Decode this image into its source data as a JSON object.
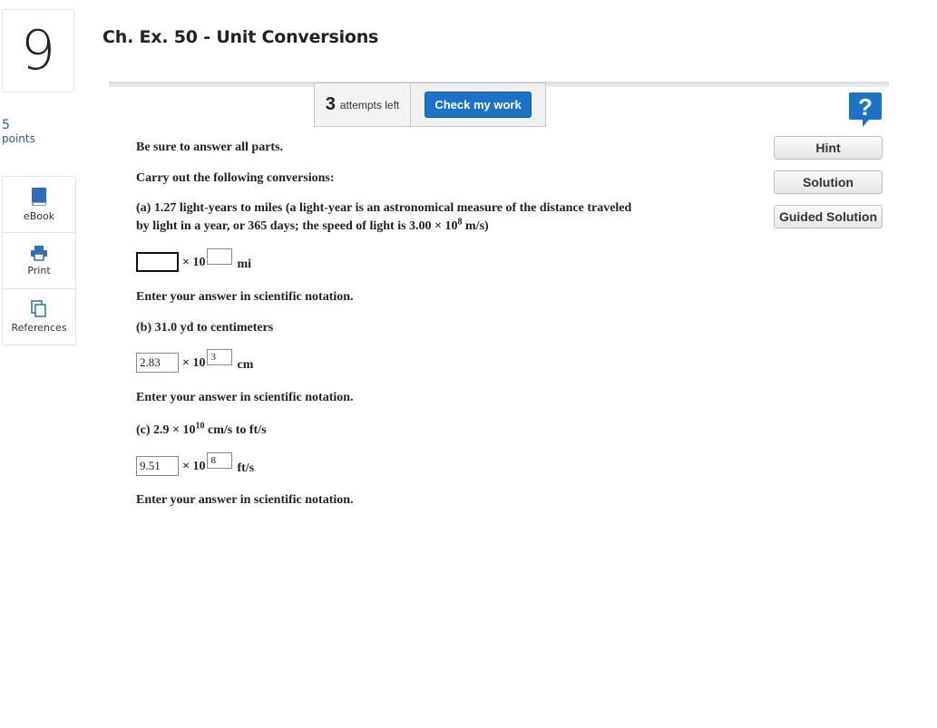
{
  "question": {
    "number": "9",
    "points_value": "5",
    "points_label": "points",
    "title": "Ch. Ex. 50 - Unit Conversions"
  },
  "tools": [
    {
      "label": "eBook",
      "icon": "book-icon"
    },
    {
      "label": "Print",
      "icon": "printer-icon"
    },
    {
      "label": "References",
      "icon": "copy-icon"
    }
  ],
  "attempts": {
    "count": "3",
    "label": "attempts left",
    "check_button": "Check my work"
  },
  "side_buttons": {
    "hint": "Hint",
    "solution": "Solution",
    "guided": "Guided Solution"
  },
  "colors": {
    "accent": "#1a73c9",
    "points": "#2e5d8a"
  },
  "body": {
    "intro1": "Be sure to answer all parts.",
    "intro2": "Carry out the following conversions:",
    "part_a_prefix": "(a) 1.27 light-years to miles (a light-year is an astronomical measure of the distance traveled by light in a year, or 365 days; the speed of light is 3.00 × 10",
    "part_a_sup": "8",
    "part_a_suffix": " m/s)",
    "times_ten": "× 10",
    "a_mantissa": "",
    "a_exponent": "",
    "a_unit": "mi",
    "sci_note": "Enter your answer in scientific notation.",
    "part_b": "(b) 31.0 yd to centimeters",
    "b_mantissa": "2.83",
    "b_exponent": "3",
    "b_unit": "cm",
    "part_c_prefix": "(c) 2.9 × 10",
    "part_c_sup": "10",
    "part_c_suffix": " cm/s to ft/s",
    "c_mantissa": "9.51",
    "c_exponent": "8",
    "c_unit": "ft/s"
  }
}
